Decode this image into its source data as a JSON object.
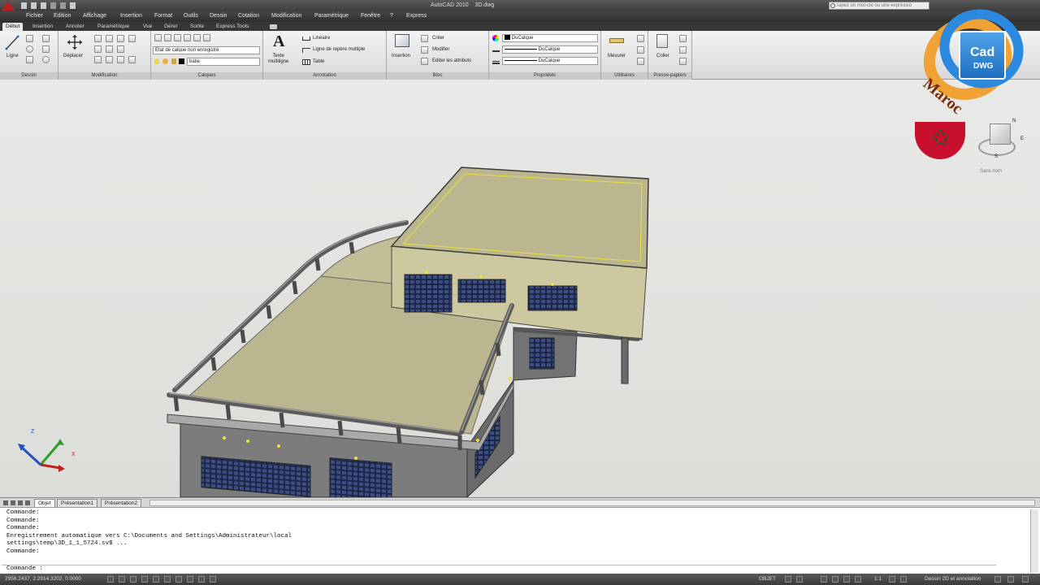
{
  "title": {
    "app": "AutoCAD 2010",
    "file": "3D.dwg",
    "search_placeholder": "Tapez un mot-clé ou une expressio"
  },
  "menu": [
    "Fichier",
    "Edition",
    "Affichage",
    "Insertion",
    "Format",
    "Outils",
    "Dessin",
    "Cotation",
    "Modification",
    "Paramétrique",
    "Fenêtre",
    "?",
    "Express"
  ],
  "ribbon_tabs": [
    "Début",
    "Insertion",
    "Annoter",
    "Paramétrique",
    "Vue",
    "Gérer",
    "Sortie",
    "Express Tools"
  ],
  "ribbon": {
    "dessin": {
      "label": "Dessin",
      "ligne": "Ligne"
    },
    "modification": {
      "label": "Modification",
      "deplacer": "Déplacer"
    },
    "calques": {
      "label": "Calques",
      "state": "Etat de calque non enregistré",
      "current": "batie"
    },
    "annotation": {
      "label": "Annotation",
      "texte": "Texte\nmultiligne",
      "lineaire": "Linéaire",
      "ligne_repere": "Ligne de repère multiple",
      "table": "Table"
    },
    "bloc": {
      "label": "Bloc",
      "insertion": "Insertion",
      "creer": "Créer",
      "modifier": "Modifier",
      "editer": "Editer les attributs"
    },
    "proprietes": {
      "label": "Propriétés",
      "color": "DuCalque",
      "linetype": "DuCalque",
      "lineweight": "DuCalque"
    },
    "utilitaires": {
      "label": "Utilitaires",
      "mesurer": "Mesurer"
    },
    "presse_papiers": {
      "label": "Presse-papiers",
      "coller": "Coller"
    }
  },
  "viewcube": {
    "compass": [
      "N",
      "E",
      "S"
    ],
    "view": "Sans nom"
  },
  "logo": {
    "line1": "Cad",
    "line2": "DWG",
    "word": "Maroc"
  },
  "ucs": {
    "z": "Z",
    "x": "X"
  },
  "layout_tabs": [
    "Objet",
    "Présentation1",
    "Présentation2"
  ],
  "command_lines": [
    "Commande:",
    "Commande:",
    "Commande:",
    "Enregistrement automatique vers C:\\Documents and Settings\\Administrateur\\local",
    "settings\\temp\\3D_1_1_5724.sv$ ...",
    "Commande:"
  ],
  "command_prompt": "Commande :",
  "status": {
    "coords": "2956.2437, 2.2914.3202, 0.0000",
    "objet": "OBJET",
    "scale": "1:1",
    "workspace": "Dessin 2D et annotation"
  },
  "colors": {
    "roof": "#bcb690",
    "wall": "#cdc8a0",
    "ground_wall": "#808080",
    "railing": "#6a6a6a",
    "accent_yellow": "#e8e23a",
    "title_bg": "#3c3c3c"
  }
}
